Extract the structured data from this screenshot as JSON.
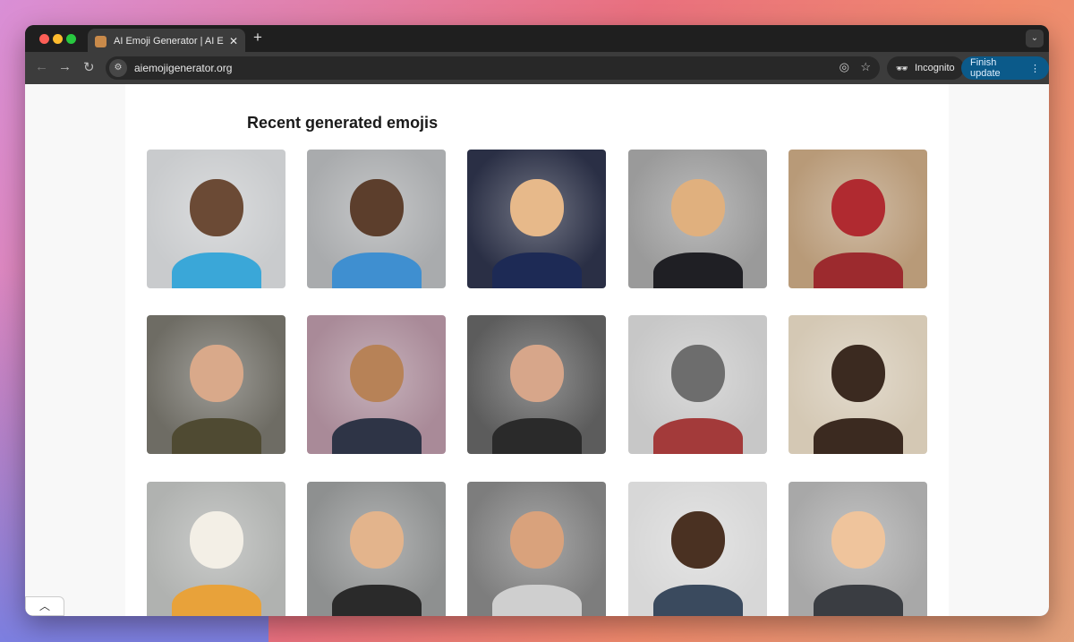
{
  "browser": {
    "tab_title": "AI Emoji Generator | AI Emoji Generator",
    "new_tab_label": "+",
    "url": "aiemojigenerator.org",
    "incognito_label": "Incognito",
    "update_label": "Finish update"
  },
  "page": {
    "heading": "Recent generated emojis",
    "tiles": [
      {
        "bg": "#c9cbcd",
        "head": "#6b4a35",
        "body": "#3aa7d8"
      },
      {
        "bg": "#a9abad",
        "head": "#5c3e2c",
        "body": "#3f8fd0"
      },
      {
        "bg": "#2a2f45",
        "head": "#e7b98a",
        "body": "#1d2a55"
      },
      {
        "bg": "#9a9a9a",
        "head": "#e0b07e",
        "body": "#1f1f24"
      },
      {
        "bg": "#b89a78",
        "head": "#b02a30",
        "body": "#9c2a2e"
      },
      {
        "bg": "#6e6c64",
        "head": "#d9a98a",
        "body": "#4f4a32"
      },
      {
        "bg": "#a98a98",
        "head": "#b78257",
        "body": "#2e3446"
      },
      {
        "bg": "#5c5c5c",
        "head": "#d7a68a",
        "body": "#2a2a2a"
      },
      {
        "bg": "#c7c7c7",
        "head": "#6d6d6d",
        "body": "#a33a3a"
      },
      {
        "bg": "#d4c8b4",
        "head": "#3b2a20",
        "body": "#3b2a20"
      },
      {
        "bg": "#b0b2b0",
        "head": "#f3efe6",
        "body": "#e8a23a"
      },
      {
        "bg": "#8e9090",
        "head": "#e3b48c",
        "body": "#2a2a2a"
      },
      {
        "bg": "#7d7d7d",
        "head": "#d9a27c",
        "body": "#cfcfcf"
      },
      {
        "bg": "#d7d7d7",
        "head": "#4a3122",
        "body": "#3a4a5e"
      },
      {
        "bg": "#a8a8a8",
        "head": "#efc49c",
        "body": "#3a3d42"
      }
    ]
  }
}
